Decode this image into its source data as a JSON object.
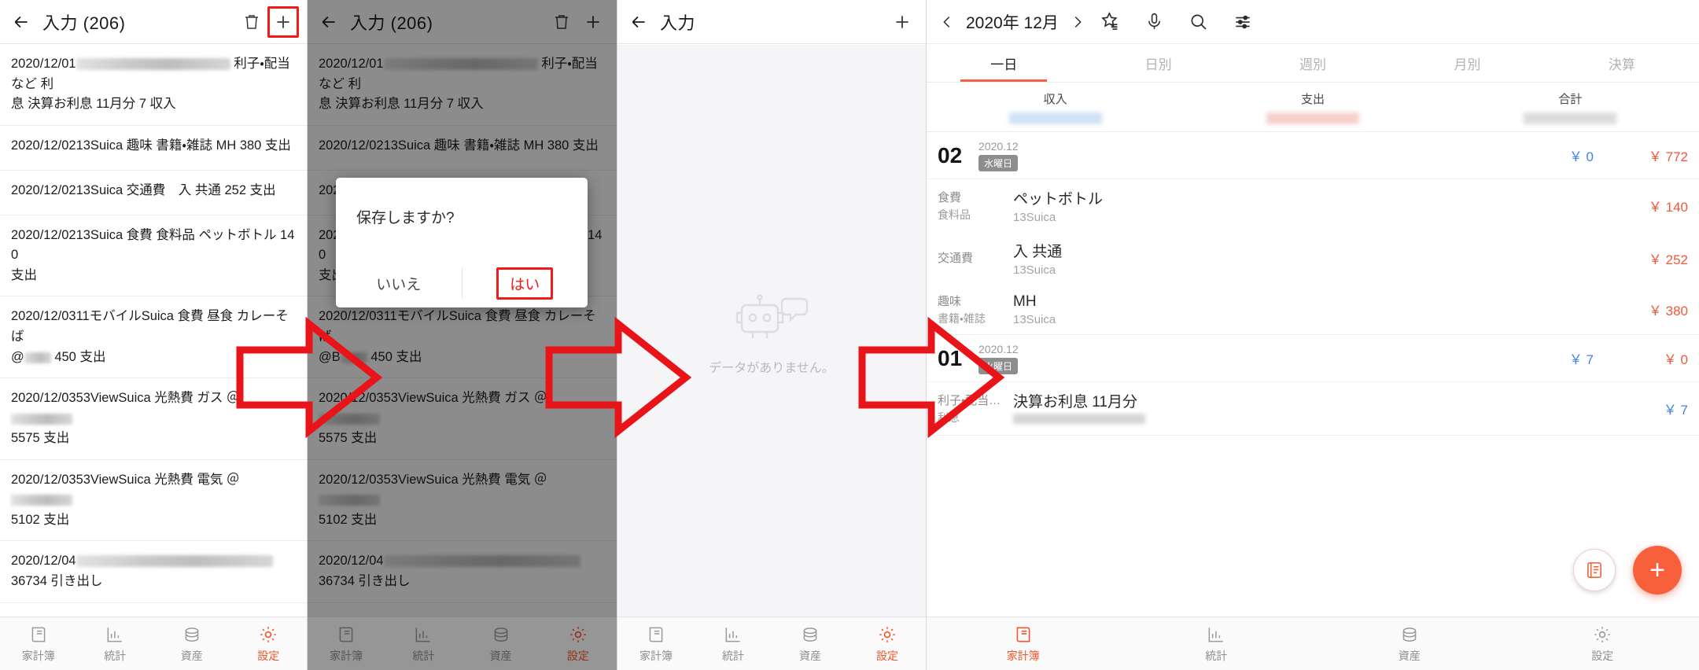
{
  "panel1": {
    "appbar": {
      "title": "入力 (206)",
      "back_icon": "arrow-left-icon",
      "delete_icon": "trash-icon",
      "add_icon": "plus-icon"
    },
    "rows": [
      {
        "line1_pre": "2020/12/01",
        "redacted": "wide",
        "line1_post": "利子・配当など 利",
        "line2": "息 決算お利息 11月分 7 収入"
      },
      {
        "line1_pre": "2020/12/0213Suica 趣味 書籍・雑誌 MH 380 支出",
        "redacted": "none",
        "line1_post": "",
        "line2": ""
      },
      {
        "line1_pre": "2020/12/0213Suica 交通費　入 共通 252 支出",
        "redacted": "none",
        "line1_post": "",
        "line2": ""
      },
      {
        "line1_pre": "2020/12/0213Suica 食費 食料品 ペットボトル 140",
        "redacted": "none",
        "line1_post": "",
        "line2": "支出"
      },
      {
        "line1_pre": "2020/12/0311モバイルSuica 食費 昼食 カレーそば",
        "redacted": "none",
        "line1_post": "",
        "line2": "@　450 支出"
      },
      {
        "line1_pre": "2020/12/0353ViewSuica 光熱費 ガス ＠",
        "redacted": "mid",
        "line1_post": "",
        "line2": "5575 支出"
      },
      {
        "line1_pre": "2020/12/0353ViewSuica 光熱費 電気 ＠",
        "redacted": "mid",
        "line1_post": "",
        "line2": "5102 支出"
      },
      {
        "line1_pre": "2020/12/04",
        "redacted": "xl",
        "line1_post": "",
        "line2": "36734 引き出し"
      }
    ]
  },
  "panel2": {
    "appbar": {
      "title": "入力 (206)",
      "back_icon": "arrow-left-icon",
      "delete_icon": "trash-icon",
      "add_icon": "plus-icon"
    },
    "dialog": {
      "message": "保存しますか?",
      "no_label": "いいえ",
      "yes_label": "はい"
    }
  },
  "panel3": {
    "appbar": {
      "title": "入力",
      "back_icon": "arrow-left-icon",
      "add_icon": "plus-icon"
    },
    "empty": {
      "text": "データがありません。",
      "icon": "robot-chat-icon"
    }
  },
  "panel4": {
    "appbar": {
      "prev_icon": "chevron-left-icon",
      "period": "2020年 12月",
      "next_icon": "chevron-right-icon",
      "star_icon": "star-list-icon",
      "mic_icon": "microphone-icon",
      "search_icon": "search-icon",
      "filter_icon": "sliders-icon"
    },
    "tabs": [
      {
        "label": "一日",
        "active": true
      },
      {
        "label": "日別",
        "active": false
      },
      {
        "label": "週別",
        "active": false
      },
      {
        "label": "月別",
        "active": false
      },
      {
        "label": "決算",
        "active": false
      }
    ],
    "summary": [
      {
        "header": "収入",
        "value_hidden": true,
        "tone": "income"
      },
      {
        "header": "支出",
        "value_hidden": true,
        "tone": "expense"
      },
      {
        "header": "合計",
        "value_hidden": true,
        "tone": "total"
      }
    ],
    "days": [
      {
        "day": "02",
        "ym": "2020.12",
        "weekday": "水曜日",
        "income": "￥ 0",
        "total": "￥ 772",
        "txns": [
          {
            "cat1": "食費",
            "cat2": "食料品",
            "title": "ペットボトル",
            "sub": "13Suica",
            "amount": "￥ 140",
            "tone": "expense"
          },
          {
            "cat1": "交通費",
            "cat2": "",
            "title": "入 共通",
            "sub": "13Suica",
            "amount": "￥ 252",
            "tone": "expense"
          },
          {
            "cat1": "趣味",
            "cat2": "書籍・雑誌",
            "title": "MH",
            "sub": "13Suica",
            "amount": "￥ 380",
            "tone": "expense"
          }
        ]
      },
      {
        "day": "01",
        "ym": "2020.12",
        "weekday": "火曜日",
        "income": "￥ 7",
        "total": "￥ 0",
        "txns": [
          {
            "cat1": "利子・配当…",
            "cat2": "利息",
            "title": "決算お利息 11月分",
            "sub": "",
            "sub_hidden": true,
            "amount": "￥ 7",
            "tone": "income"
          }
        ]
      }
    ],
    "fab": {
      "list_icon": "list-note-icon",
      "add_label": "+"
    }
  },
  "bottom_nav": {
    "items": [
      {
        "label": "家計簿",
        "icon": "book-icon"
      },
      {
        "label": "統計",
        "icon": "bar-chart-icon"
      },
      {
        "label": "資産",
        "icon": "coins-icon"
      },
      {
        "label": "設定",
        "icon": "gear-icon"
      }
    ],
    "active_panel1": 3,
    "active_panel2": 3,
    "active_panel3": 3,
    "active_panel4": 0
  },
  "colors": {
    "accent": "#f2552c",
    "highlight": "#ee1b19",
    "income": "#3f82f2",
    "expense": "#f2573a",
    "muted": "#8e8e8e"
  }
}
